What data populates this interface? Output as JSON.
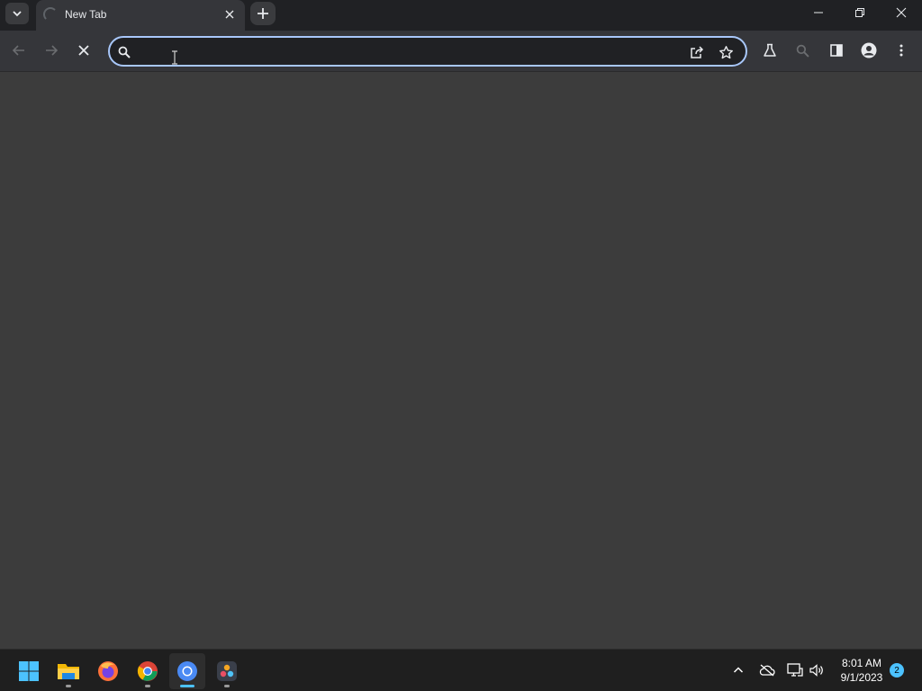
{
  "browser": {
    "tab": {
      "title": "New Tab",
      "loading": true
    },
    "omnibox": {
      "value": "",
      "placeholder": ""
    }
  },
  "taskbar": {
    "apps": [
      {
        "name": "Start",
        "icon": "windows-start-icon"
      },
      {
        "name": "File Explorer",
        "icon": "folder-icon"
      },
      {
        "name": "Firefox",
        "icon": "firefox-icon"
      },
      {
        "name": "Google Chrome",
        "icon": "chrome-icon"
      },
      {
        "name": "Chromium",
        "icon": "chromium-icon",
        "active": true
      },
      {
        "name": "DaVinci Resolve",
        "icon": "davinci-icon"
      }
    ],
    "clock": {
      "time": "8:01 AM",
      "date": "9/1/2023"
    },
    "notification_count": "2"
  },
  "colors": {
    "titlebar": "#202124",
    "toolbar": "#35363a",
    "content": "#3c3c3c",
    "focus_ring": "#a8c7fa",
    "taskbar": "#1f1f1f",
    "accent": "#4cc2ff"
  }
}
